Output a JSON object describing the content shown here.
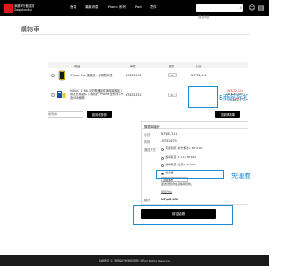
{
  "header": {
    "logo_text_top": "添讚得行動通訊",
    "logo_text_bottom": "ZagoSunday",
    "nav": [
      "首頁",
      "最新消息",
      "iPhone 系列",
      "iPad",
      "配件"
    ],
    "search_placeholder": "搜尋商品"
  },
  "page": {
    "title": "購物車"
  },
  "cart": {
    "columns": [
      "商品",
      "單價",
      "數量",
      "小計"
    ],
    "items": [
      {
        "name": "iPhone 16e 保護殼 - 透明防摔殼",
        "price": "NT$32,990",
        "qty": "1",
        "subtotal": "NT$32,990"
      },
      {
        "name": "MAGIC 1768-3 充電器組件與保護膜組 / 電池充電組件 / 適用於 iPhone 全系列 (不含USB線材)",
        "price": "NT$32,321",
        "qty": "1",
        "discount_lines": [
          "NT$32,321",
          "NT$35,000",
          "-NT$2,679"
        ]
      }
    ],
    "coupon_placeholder": "優惠券",
    "apply_coupon": "套用優惠券",
    "update_cart": "更新購物車"
  },
  "summary": {
    "title": "購物車總計",
    "rows": [
      {
        "label": "小計",
        "value": "NT$65,311"
      },
      {
        "label": "折扣",
        "value": "-NT$2,679"
      }
    ],
    "shipping_label": "運送方式",
    "shipping_options": [
      "宅配到府 (新竹縣市): NT$100",
      "超商取貨 (7-11): NT$60",
      "超商取貨 (全家): NT$60"
    ],
    "free_shipping_label": "免運費",
    "shipping_select": "選擇縣市",
    "shipping_note": "運送選項會在結帳時更新。",
    "change_address": "變更地址",
    "total_label": "總計",
    "total_value": "NT$62,632",
    "checkout": "前往結帳"
  },
  "annotations": {
    "discount_note": "B商品折扣",
    "free_shipping_note": "免運費"
  },
  "footer": {
    "text": "版權所有 © 添讚得行動通訊有限公司 All Rights Reserved"
  },
  "colors": {
    "brand_red": "#d51d1d",
    "annotation_blue": "#1d8bd6",
    "header_bg": "#000000"
  }
}
